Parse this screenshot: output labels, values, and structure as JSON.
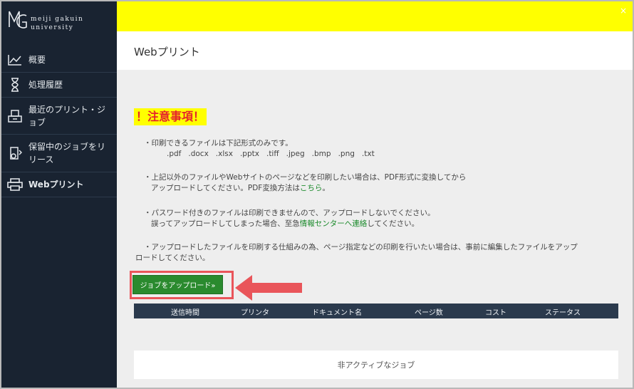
{
  "logo": {
    "line1": "meiji gakuin",
    "line2": "university"
  },
  "sidebar": {
    "items": [
      {
        "label": "概要",
        "icon": "chart-line-icon"
      },
      {
        "label": "処理履歴",
        "icon": "hourglass-icon"
      },
      {
        "label": "最近のプリント・ジョブ",
        "icon": "printer-tray-icon"
      },
      {
        "label": "保留中のジョブをリリース",
        "icon": "hold-job-icon"
      },
      {
        "label": "Webプリント",
        "icon": "web-print-icon"
      }
    ]
  },
  "header": {
    "close": "×"
  },
  "page": {
    "title": "Webプリント"
  },
  "notice": {
    "heading": "！注意事項！",
    "p1_line1": "・印刷できるファイルは下記形式のみです。",
    "p1_line2": ".pdf   .docx   .xlsx   .pptx   .tiff   .jpeg   .bmp   .png   .txt",
    "p2_line1": "・上記以外のファイルやWebサイトのページなどを印刷したい場合は、PDF形式に変換してから",
    "p2_line2": "アップロードしてください。PDF変換方法は",
    "p2_link": "こちら",
    "p2_end": "。",
    "p3_line1": "・パスワード付きのファイルは印刷できませんので、アップロードしないでください。",
    "p3_line2a": "誤ってアップロードしてしまった場合、至急",
    "p3_link": "情報センターへ連絡",
    "p3_line2b": "してください。",
    "p4_line1": "・アップロードしたファイルを印刷する仕組みの為、ページ指定などの印刷を行いたい場合は、事前に編集したファイルをアップ",
    "p4_line2": "ロードしてください。"
  },
  "upload": {
    "label": "ジョブをアップロード»"
  },
  "table": {
    "columns": [
      "送信時間",
      "プリンタ",
      "ドキュメント名",
      "ページ数",
      "コスト",
      "ステータス"
    ]
  },
  "inactive": {
    "label": "非アクティブなジョブ"
  },
  "colors": {
    "sidebar": "#192331",
    "yellow": "#ffff00",
    "green": "#2a8a2e",
    "red": "#e9555a"
  }
}
